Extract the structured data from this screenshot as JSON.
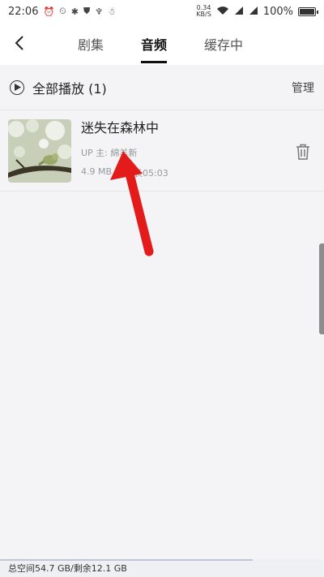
{
  "status_bar": {
    "time": "22:06",
    "net_speed_value": "0.34",
    "net_speed_unit": "KB/S",
    "battery": "100%"
  },
  "header": {
    "tabs": [
      {
        "label": "剧集",
        "active": false
      },
      {
        "label": "音频",
        "active": true
      },
      {
        "label": "缓存中",
        "active": false
      }
    ]
  },
  "play_all": {
    "label": "全部播放 (1)",
    "manage_label": "管理"
  },
  "items": [
    {
      "title": "迷失在森林中",
      "uploader": "UP 主: 綿羊新",
      "size": "4.9 MB",
      "duration": "时长05:03"
    }
  ],
  "footer": {
    "storage_text": "总空间54.7 GB/剩余12.1 GB",
    "used_fraction": 0.78
  },
  "colors": {
    "annotation_arrow": "#e31b1b"
  }
}
